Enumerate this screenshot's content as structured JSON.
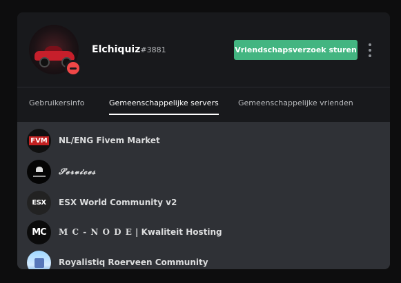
{
  "profile": {
    "username": "Elchiquiz",
    "discriminator": "#3881",
    "friend_button_label": "Vriendschapsverzoek sturen",
    "status": "do-not-disturb"
  },
  "tabs": [
    {
      "label": "Gebruikersinfo",
      "active": false
    },
    {
      "label": "Gemeenschappelijke servers",
      "active": true
    },
    {
      "label": "Gemeenschappelijke vrienden",
      "active": false
    }
  ],
  "servers": [
    {
      "name": "NL/ENG Fivem Market",
      "icon_text": "FVM",
      "icon": "fvm-server-icon"
    },
    {
      "name": "𝓢𝓮𝓻𝓿𝓲𝓬𝓮𝓼",
      "icon_text": "",
      "icon": "services-server-icon"
    },
    {
      "name": "ESX World Community v2",
      "icon_text": "ESX",
      "icon": "esx-server-icon"
    },
    {
      "name_part_1": "M C - N O D E",
      "name_part_2": " | Kwaliteit Hosting",
      "icon_text": "MC",
      "icon": "mc-node-server-icon"
    },
    {
      "name": "Royalistiq Roerveen Community",
      "icon_text": "",
      "icon": "royalistiq-server-icon"
    }
  ],
  "colors": {
    "accent_green": "#43b581",
    "dnd_red": "#f04747",
    "modal_bg": "#18191c",
    "list_bg": "#2f3136"
  }
}
